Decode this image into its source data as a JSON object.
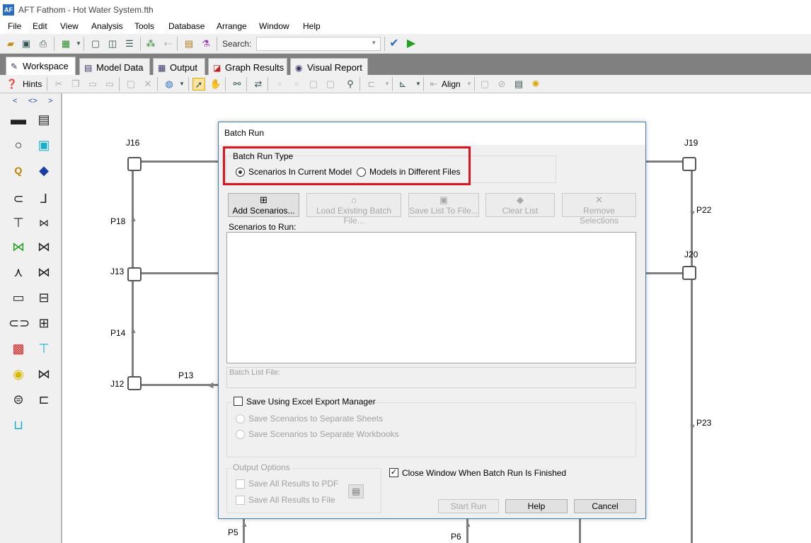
{
  "window": {
    "title": "AFT Fathom - Hot Water System.fth",
    "app_icon_text": "AF"
  },
  "menu": [
    "File",
    "Edit",
    "View",
    "Analysis",
    "Tools",
    "Database",
    "Arrange",
    "Window",
    "Help"
  ],
  "toolbar": {
    "search_label": "Search:",
    "search_value": ""
  },
  "tabs": [
    {
      "label": "Workspace",
      "active": true
    },
    {
      "label": "Model Data",
      "active": false
    },
    {
      "label": "Output",
      "active": false
    },
    {
      "label": "Graph Results",
      "active": false
    },
    {
      "label": "Visual Report",
      "active": false
    }
  ],
  "toolbar2": {
    "hints_label": "Hints",
    "align_label": "Align"
  },
  "palette": {
    "nav_prev": "<",
    "nav_both": "<>",
    "nav_next": ">"
  },
  "workspace": {
    "junctions": [
      "J16",
      "J13",
      "J12",
      "J19",
      "J20"
    ],
    "pipes": [
      "P18",
      "P14",
      "P13",
      "P22",
      "P23",
      "P5",
      "P6"
    ]
  },
  "dialog": {
    "title": "Batch Run",
    "batch_run_type": {
      "title": "Batch Run Type",
      "option_current": "Scenarios In Current Model",
      "option_files": "Models in Different Files",
      "selected": "Scenarios In Current Model"
    },
    "buttons": {
      "add_scenarios": "Add Scenarios...",
      "load_existing": "Load Existing Batch File...",
      "save_list": "Save List To File...",
      "clear_list": "Clear List",
      "remove_selections": "Remove Selections"
    },
    "scenarios_label": "Scenarios to Run:",
    "batch_list_placeholder": "Batch List File:",
    "excel": {
      "label": "Save Using Excel Export Manager",
      "checked": false,
      "option_sheets": "Save Scenarios to Separate Sheets",
      "option_workbooks": "Save Scenarios to Separate Workbooks"
    },
    "output_options": {
      "title": "Output Options",
      "pdf": "Save All Results to PDF",
      "file": "Save All Results to File"
    },
    "close_when_finished": {
      "label": "Close Window When Batch Run Is Finished",
      "checked": true
    },
    "footer": {
      "start": "Start Run",
      "help": "Help",
      "cancel": "Cancel"
    }
  },
  "colors": {
    "highlight": "#e0141e",
    "pipe": "#7f7f7f",
    "tab_bar": "#808080"
  }
}
